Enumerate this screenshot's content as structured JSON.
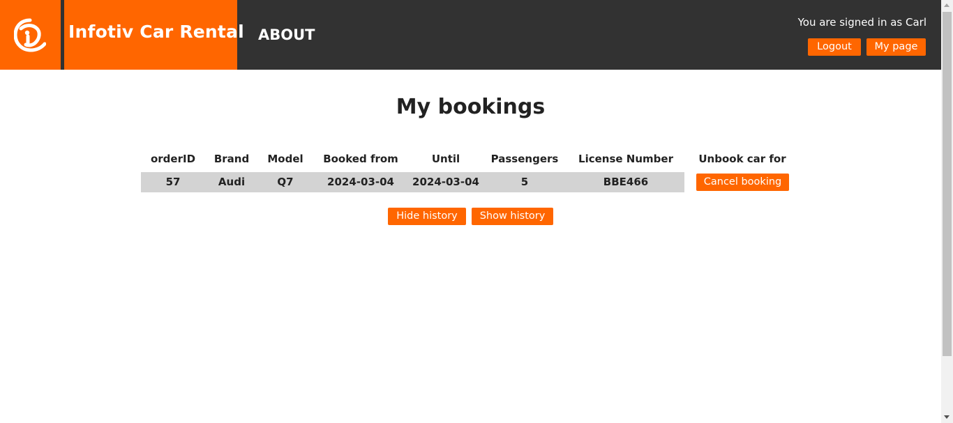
{
  "header": {
    "brand": "Infotiv Car Rental",
    "nav_about": "ABOUT",
    "signed_in_text": "You are signed in as Carl",
    "logout_label": "Logout",
    "mypage_label": "My page",
    "logo_icon": "infotiv-logo-icon",
    "accent_color": "#ff6600",
    "header_color": "#323232"
  },
  "main": {
    "title": "My bookings",
    "columns": [
      "orderID",
      "Brand",
      "Model",
      "Booked from",
      "Until",
      "Passengers",
      "License Number",
      "Unbook car for"
    ],
    "rows": [
      {
        "orderID": "57",
        "brand": "Audi",
        "model": "Q7",
        "booked_from": "2024-03-04",
        "until": "2024-03-04",
        "passengers": "5",
        "license": "BBE466",
        "action_label": "Cancel booking"
      }
    ],
    "hide_history_label": "Hide history",
    "show_history_label": "Show history"
  }
}
